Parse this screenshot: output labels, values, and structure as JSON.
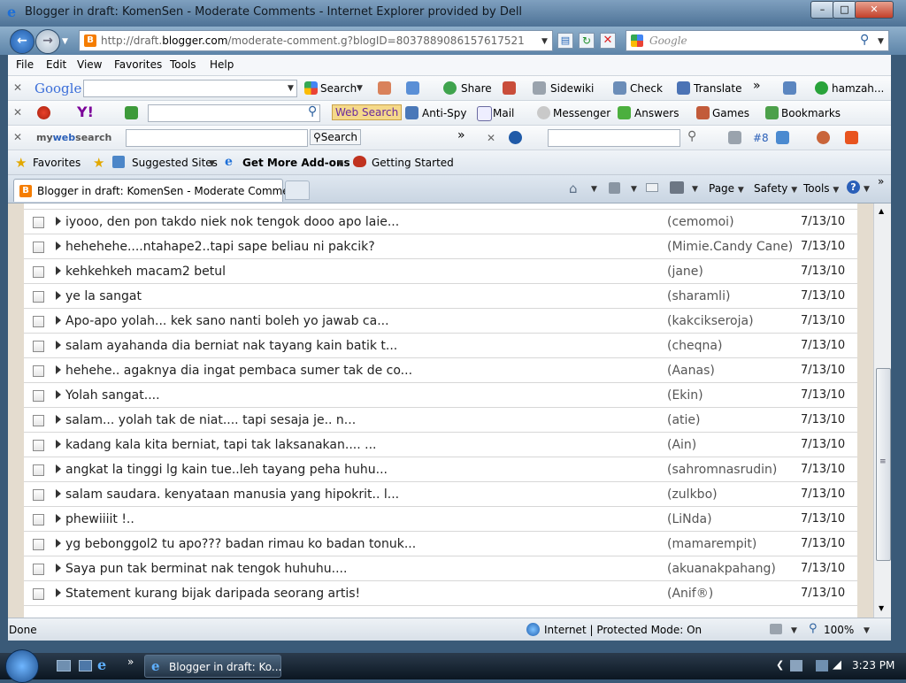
{
  "window": {
    "title": "Blogger in draft: KomenSen - Moderate Comments - Internet Explorer provided by Dell"
  },
  "address": {
    "url_prefix": "http://draft.",
    "url_domain": "blogger.com",
    "url_rest": "/moderate-comment.g?blogID=8037889086157617521"
  },
  "search": {
    "placeholder": "Google"
  },
  "menu": [
    "File",
    "Edit",
    "View",
    "Favorites",
    "Tools",
    "Help"
  ],
  "google_toolbar": {
    "brand": "Google",
    "search": "Search",
    "share": "Share",
    "sidewiki": "Sidewiki",
    "check": "Check",
    "translate": "Translate",
    "user": "hamzah..."
  },
  "yahoo_toolbar": {
    "web_search": "Web Search",
    "anti_spy": "Anti-Spy",
    "mail": "Mail",
    "messenger": "Messenger",
    "answers": "Answers",
    "games": "Games",
    "bookmarks": "Bookmarks"
  },
  "mywebsearch_toolbar": {
    "brand_my": "my",
    "brand_web": "web",
    "brand_search": "search",
    "search": "Search",
    "badge": "#8"
  },
  "favorites_bar": {
    "favorites": "Favorites",
    "suggested": "Suggested Sites",
    "addons": "Get More Add-ons",
    "getting_started": "Getting Started"
  },
  "tab": {
    "title": "Blogger in draft: KomenSen - Moderate Comments"
  },
  "command_bar": {
    "page": "Page",
    "safety": "Safety",
    "tools": "Tools"
  },
  "comments": [
    {
      "text": "iyooo, den pon takdo niek nok tengok dooo apo laie...",
      "author": "(cemomoi)",
      "date": "7/13/10"
    },
    {
      "text": "hehehehe....ntahape2..tapi sape beliau ni pakcik?",
      "author": "(Mimie.Candy Cane)",
      "date": "7/13/10"
    },
    {
      "text": "kehkehkeh macam2 betul",
      "author": "(jane)",
      "date": "7/13/10"
    },
    {
      "text": "ye la sangat",
      "author": "(sharamli)",
      "date": "7/13/10"
    },
    {
      "text": "Apo-apo yolah... kek sano nanti boleh yo jawab ca...",
      "author": "(kakcikseroja)",
      "date": "7/13/10"
    },
    {
      "text": "salam ayahanda dia berniat nak tayang kain batik t...",
      "author": "(cheqna)",
      "date": "7/13/10"
    },
    {
      "text": "hehehe.. agaknya dia ingat pembaca sumer tak de co...",
      "author": "(Aanas)",
      "date": "7/13/10"
    },
    {
      "text": "Yolah sangat....",
      "author": "(Ekin)",
      "date": "7/13/10"
    },
    {
      "text": "salam... yolah tak de niat.... tapi sesaja je.. n...",
      "author": "(atie)",
      "date": "7/13/10"
    },
    {
      "text": "kadang kala kita berniat, tapi tak laksanakan.... ...",
      "author": "(Ain)",
      "date": "7/13/10"
    },
    {
      "text": "angkat la tinggi lg kain tue..leh tayang peha huhu...",
      "author": "(sahromnasrudin)",
      "date": "7/13/10"
    },
    {
      "text": "salam saudara. kenyataan manusia yang hipokrit.. l...",
      "author": "(zulkbo)",
      "date": "7/13/10"
    },
    {
      "text": "phewiiiit !..",
      "author": "(LiNda)",
      "date": "7/13/10"
    },
    {
      "text": "yg bebonggol2 tu apo??? badan rimau ko badan tonuk...",
      "author": "(mamarempit)",
      "date": "7/13/10"
    },
    {
      "text": "Saya pun tak berminat nak tengok huhuhu....",
      "author": "(akuanakpahang)",
      "date": "7/13/10"
    },
    {
      "text": "Statement kurang bijak daripada seorang artis!",
      "author": "(Anif®)",
      "date": "7/13/10"
    }
  ],
  "status": {
    "left": "Done",
    "zone": "Internet | Protected Mode: On",
    "zoom": "100%"
  },
  "taskbar": {
    "item": "Blogger in draft: Ko...",
    "clock": "3:23 PM"
  }
}
